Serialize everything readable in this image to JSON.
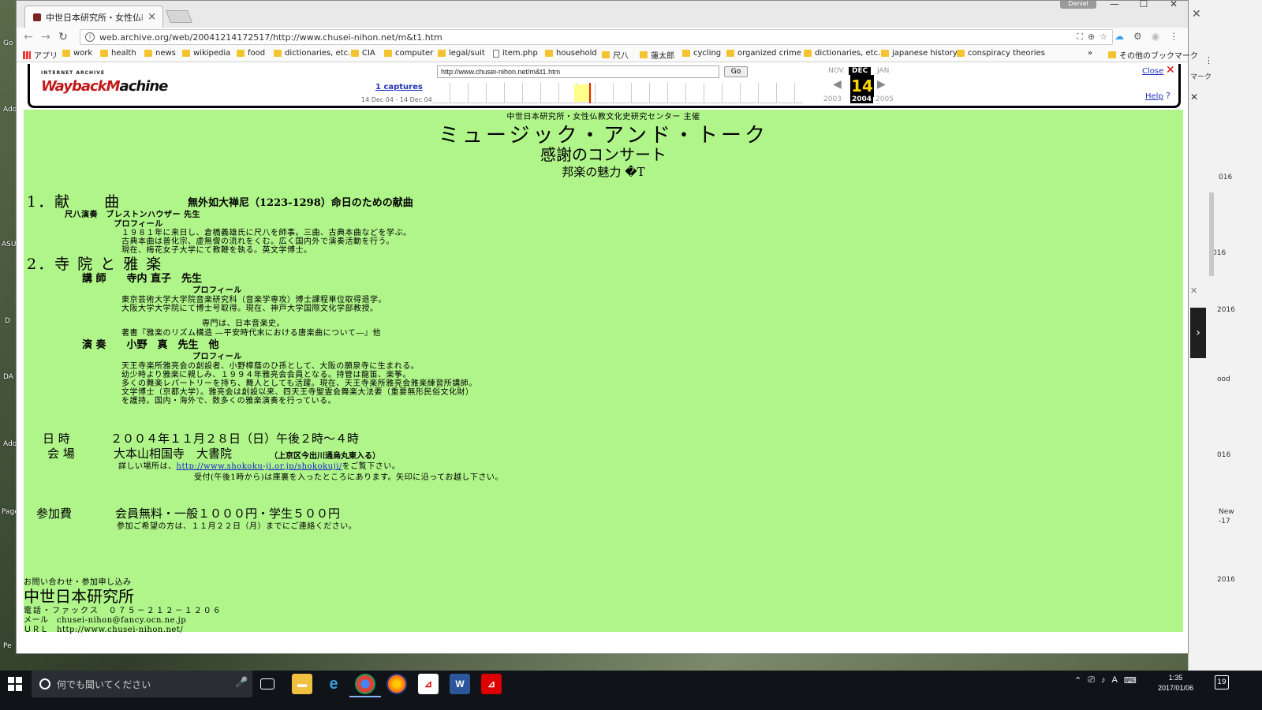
{
  "tab": {
    "title": "中世日本研究所・女性仏教",
    "close": "×"
  },
  "window": {
    "user": "Daniel",
    "minimize": "—",
    "maximize": "☐",
    "close": "✕"
  },
  "address": {
    "url": "web.archive.org/web/20041214172517/http://www.chusei-nihon.net/m&t1.htm",
    "info": "i"
  },
  "bookmarks": {
    "items": [
      {
        "label": "アプリ",
        "icon": "apps-icon"
      },
      {
        "label": "work",
        "icon": "folder-icon"
      },
      {
        "label": "health",
        "icon": "folder-icon"
      },
      {
        "label": "news",
        "icon": "folder-icon"
      },
      {
        "label": "wikipedia",
        "icon": "folder-icon"
      },
      {
        "label": "food",
        "icon": "folder-icon"
      },
      {
        "label": "dictionaries, etc.",
        "icon": "folder-icon"
      },
      {
        "label": "CIA",
        "icon": "folder-icon"
      },
      {
        "label": "computer",
        "icon": "folder-icon"
      },
      {
        "label": "legal/suit",
        "icon": "folder-icon"
      },
      {
        "label": "item.php",
        "icon": "page-icon"
      },
      {
        "label": "household",
        "icon": "folder-icon"
      },
      {
        "label": "尺八",
        "icon": "folder-icon"
      },
      {
        "label": "蓮太郎",
        "icon": "folder-icon"
      },
      {
        "label": "cycling",
        "icon": "folder-icon"
      },
      {
        "label": "organized crime",
        "icon": "folder-icon"
      },
      {
        "label": "dictionaries, etc.",
        "icon": "folder-icon"
      },
      {
        "label": "japanese history",
        "icon": "folder-icon"
      },
      {
        "label": "conspiracy theories",
        "icon": "folder-icon"
      }
    ],
    "more": "»",
    "other": "その他のブックマーク"
  },
  "wayback": {
    "logo_top": "INTERNET ARCHIVE",
    "logo_red": "WaybackM",
    "logo_black": "achine",
    "url_value": "http://www.chusei-nihon.net/m&t1.htm",
    "go": "Go",
    "captures": "1 captures",
    "range": "14 Dec 04 - 14 Dec 04",
    "prev_month": "NOV",
    "cur_month": "DEC",
    "next_month": "JAN",
    "day": "14",
    "prev_year": "2003",
    "cur_year": "2004",
    "next_year": "2005",
    "close": "Close",
    "help": "Help"
  },
  "page": {
    "organizer": "中世日本研究所・女性仏教文化史研究センター 主催",
    "title": "ミュージック・アンド・トーク",
    "subtitle": "感謝のコンサート",
    "subtitle2": "邦楽の魅力 �T",
    "s1_num": "1．献　　曲",
    "s1_title": "無外如大禅尼（1223-1298）命日のための献曲",
    "s1_role": "尺八演奏　ブレストンハウザー 先生",
    "s1_profile": "プロフィール",
    "s1_p1": "１９８１年に来日し、倉橋義雄氏に尺八を師事。三曲、古典本曲などを学ぶ。",
    "s1_p2": "古典本曲は普化宗、虚無僧の流れをくむ。広く国内外で演奏活動を行う。",
    "s1_p3": "現在、梅花女子大学にて教鞭を執る。英文学博士。",
    "s2_num": "2．寺 院 と 雅 楽",
    "s2_role": "講 師　　寺内 直子　先生",
    "s2_profile": "プロフィール",
    "s2_p1": "東京芸術大学大学院音楽研究科（音楽学専攻）博士課程単位取得退学。",
    "s2_p2": "大阪大学大学院にて博士号取得。現在、神戸大学国際文化学部教授。",
    "s2_p3": "専門は、日本音楽史。",
    "s2_p4": "著書『雅楽のリズム構造 ―平安時代末における唐楽曲について―』他",
    "s3_role": "演 奏　　小野　真　先生　他",
    "s3_profile": "プロフィール",
    "s3_p1": "天王寺楽所雅亮会の創設者、小野樟蔭のひ孫として、大阪の願泉寺に生まれる。",
    "s3_p2": "幼少時より雅楽に親しみ、１９９４年雅亮会会員となる。持管は龍笛、楽筝。",
    "s3_p3": "多くの舞楽レパートリーを持ち、舞人としても活躍。現在、天王寺楽所雅亮会雅楽練習所講師。",
    "s3_p4": "文学博士（京都大学）。雅亮会は創設以来、四天王寺聖霊会舞楽大法要（重要無形民俗文化財）",
    "s3_p5": "を護持。国内・海外で、数多くの雅楽演奏を行っている。",
    "date_label": "日 時",
    "date_value": "２００４年１１月２８日（日）午後２時～４時",
    "venue_label": "会 場",
    "venue_value": "大本山相国寺　大書院",
    "venue_addr": "（上京区今出川通烏丸東入る）",
    "details_pre": "詳しい場所は、",
    "details_link": "http://www.shokoku-ji.or.jp/shokokuji/",
    "details_post": "をご覧下さい。",
    "reception": "受付(午後1時から)は庫裏を入ったところにあります。矢印に沿ってお越し下さい。",
    "fee_label": "参加費",
    "fee_value": "会員無料・一般１０００円・学生５００円",
    "fee_note": "参加ご希望の方は、１１月２２日（月）までにご連絡ください。",
    "contact_label": "お問い合わせ・参加申し込み",
    "org_name": "中世日本研究所",
    "tel": "電話・ファックス　０７５－２１２－１２０６",
    "mail": "メール　chusei-nihon@fancy.ocn.ne.jp",
    "url": "ＵＲＬ　http://www.chusei-nihon.net/"
  },
  "taskbar": {
    "search_placeholder": "何でも聞いてください",
    "time": "1:35",
    "date": "2017/01/06",
    "ime": "A",
    "notifications": "19"
  },
  "background_window": {
    "bookmark_tail": "マーク",
    "dates": [
      "016",
      "2016",
      "016",
      "2016",
      "ood",
      "New",
      "-17"
    ]
  },
  "desktop_labels": [
    "Go",
    "Ado",
    "ASU",
    "D",
    "DA",
    "Ado",
    "Page",
    "Pe"
  ]
}
